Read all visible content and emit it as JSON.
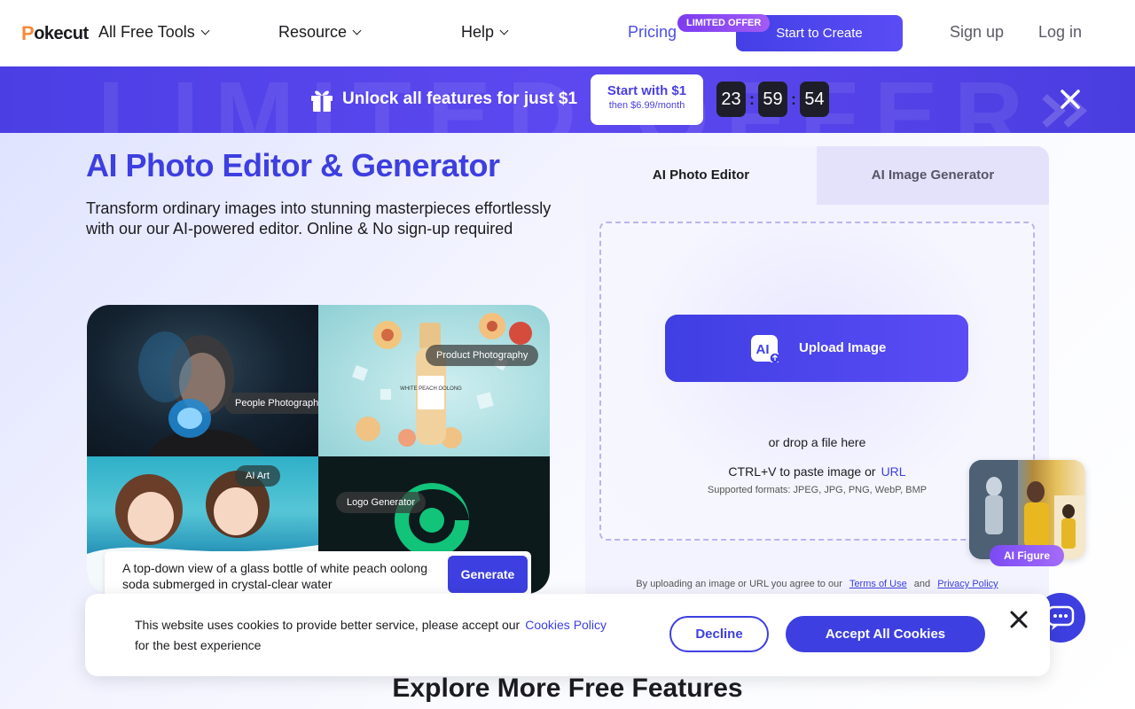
{
  "nav": {
    "logo": "Pokecut",
    "logo_first": "P",
    "logo_rest": "okecut",
    "items": [
      {
        "label": "All Free Tools"
      },
      {
        "label": "Resource"
      },
      {
        "label": "Help"
      }
    ],
    "pricing": "Pricing",
    "offer_tag": "LIMITED OFFER",
    "start_create": "Start to Create",
    "signup": "Sign up",
    "login": "Log in"
  },
  "banner": {
    "bg_text": "LIMITED OFFER",
    "text": "Unlock all features for just $1",
    "start_title": "Start with $1",
    "start_sub": "then $6.99/month",
    "timer": {
      "hours": "23",
      "minutes": "59",
      "seconds": "54"
    },
    "separator": ":"
  },
  "hero": {
    "title": "AI Photo Editor & Generator",
    "subtitle": "Transform ordinary images into stunning masterpieces effortlessly with our our AI-powered editor. Online & No sign-up required",
    "tags": {
      "people": "People Photography",
      "product": "Product Photography",
      "art": "AI Art",
      "logo": "Logo Generator"
    },
    "bottle_label": "WHITE PEACH OOLONG",
    "prompt": "A top-down view of a glass bottle of white peach oolong soda submerged in crystal-clear water",
    "generate": "Generate"
  },
  "panel": {
    "tab_editor": "AI Photo Editor",
    "tab_generator": "AI Image Generator",
    "upload": "Upload Image",
    "drop": "or drop a file here",
    "paste": "CTRL+V to paste image or",
    "url": "URL",
    "formats": "Supported formats: JPEG, JPG, PNG, WebP, BMP",
    "agree_prefix": "By uploading an image or URL you agree to our",
    "terms": "Terms of Use",
    "and": "and",
    "privacy": "Privacy Policy",
    "figure_tag": "AI Figure"
  },
  "cookie": {
    "text": "This website uses cookies to provide better service, please accept our",
    "policy": "Cookies Policy",
    "text2": "for the best experience",
    "decline": "Decline",
    "accept": "Accept All Cookies"
  },
  "explore": "Explore More Free Features",
  "colors": {
    "accent": "#3d3fe0",
    "banner": "#5246ea",
    "orange": "#f58a3a"
  }
}
